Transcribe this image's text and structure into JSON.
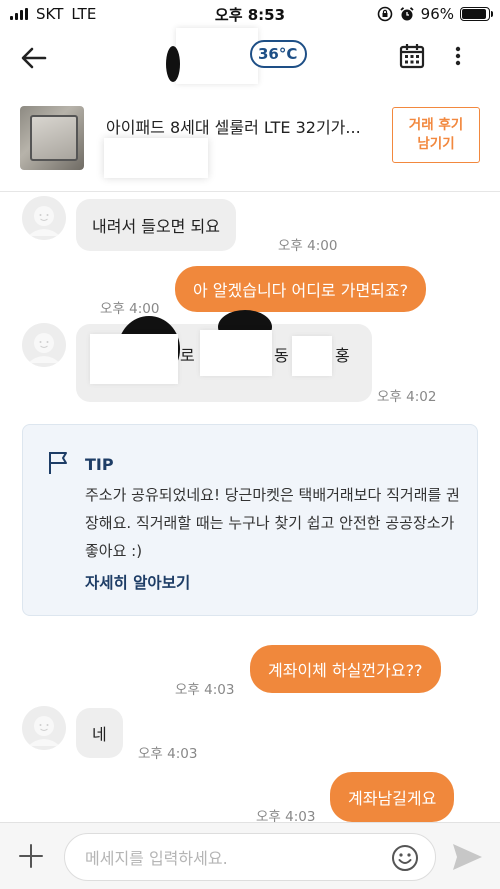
{
  "status_bar": {
    "carrier": "SKT",
    "network": "LTE",
    "time": "오후 8:53",
    "battery": "96%"
  },
  "header": {
    "temperature": "36°C"
  },
  "product": {
    "title": "아이패드 8세대 셀룰러 LTE 32기가...",
    "review_button": "거래 후기\n남기기"
  },
  "messages": [
    {
      "side": "in",
      "text": "내려서 들오면 되요",
      "time": "오후 4:00"
    },
    {
      "side": "out",
      "text": "아 알겠습니다 어디로 가면되죠?",
      "time": "오후 4:00"
    },
    {
      "side": "in",
      "text_parts": [
        "로",
        "동",
        "홍"
      ],
      "time": "오후 4:02"
    },
    {
      "side": "out",
      "text": "계좌이체 하실껀가요??",
      "time": "오후 4:03"
    },
    {
      "side": "in",
      "text": "네",
      "time": "오후 4:03"
    },
    {
      "side": "out",
      "text": "계좌남길게요",
      "time": "오후 4:03"
    }
  ],
  "tip": {
    "label": "TIP",
    "body": "주소가 공유되었네요! 당근마켓은 택배거래보다 직거래를 권장해요. 직거래할 때는 누구나 찾기 쉽고 안전한 공공장소가 좋아요 :)",
    "link": "자세히 알아보기"
  },
  "composer": {
    "placeholder": "메세지를 입력하세요."
  },
  "colors": {
    "accent": "#f0883c",
    "tip_title": "#1e3d66",
    "temp_badge": "#1e4f86"
  }
}
